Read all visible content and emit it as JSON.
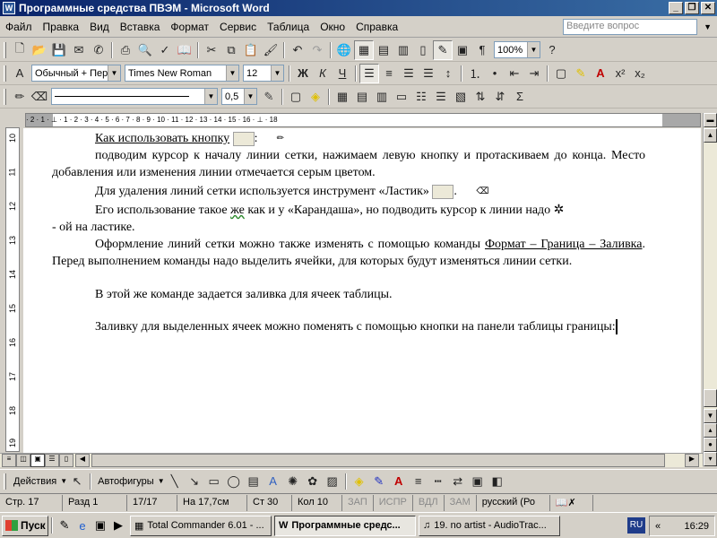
{
  "window": {
    "title": "Программные средства ПВЭМ - Microsoft Word"
  },
  "menu": {
    "items": [
      "Файл",
      "Правка",
      "Вид",
      "Вставка",
      "Формат",
      "Сервис",
      "Таблица",
      "Окно",
      "Справка"
    ],
    "help_placeholder": "Введите вопрос"
  },
  "toolbar": {
    "zoom": "100%",
    "style": "Обычный + Пер",
    "font": "Times New Roman",
    "size": "12",
    "line_weight": "0,5",
    "bold": "Ж",
    "italic": "К",
    "underline": "Ч"
  },
  "ruler": {
    "h_labels": "· 2 · 1 · ⊥ · 1 · 2 · 3 · 4 · 5 · 6 · 7 · 8 · 9 · 10 · 11 · 12 · 13 · 14 · 15 · 16 · ⊥ · 18",
    "v_labels": [
      "10",
      "11",
      "12",
      "13",
      "14",
      "15",
      "16",
      "17",
      "18",
      "19"
    ]
  },
  "document": {
    "p1_link": "Как использовать кнопку",
    "p1_tail": ":",
    "p2": "подводим курсор к началу линии сетки, нажимаем левую кнопку и протаскиваем до конца. Место добавления или изменения линии отмечается серым цветом.",
    "p3": "Для удаления линий сетки используется инструмент «Ластик»",
    "p3_tail": ".",
    "p4_a": "Его использование такое ",
    "p4_wavy": "же",
    "p4_b": " как и у «Карандаша», но подводить курсор к линии надо",
    "p4_c": "- ой на ластике.",
    "p5_a": "Оформление линий сетки можно также изменять с помощью команды ",
    "p5_link": "Формат – Граница – Заливка",
    "p5_b": ". Перед выполнением команды надо выделить ячейки, для которых будут изменяться линии сетки.",
    "p6": "В этой же команде задается заливка для ячеек таблицы.",
    "p7": "Заливку для выделенных ячеек можно поменять с помощью кнопки на панели таблицы границы:"
  },
  "drawbar": {
    "actions": "Действия",
    "autoshapes": "Автофигуры"
  },
  "status": {
    "page": "Стр.  17",
    "section": "Разд  1",
    "pages": "17/17",
    "at": "На  17,7см",
    "line": "Ст  30",
    "col": "Кол  10",
    "rec": "ЗАП",
    "trk": "ИСПР",
    "ext": "ВДЛ",
    "ovr": "ЗАМ",
    "lang": "русский (Ро"
  },
  "taskbar": {
    "start": "Пуск",
    "tasks": [
      "Total Commander 6.01 - ...",
      "Программные средс...",
      "19. no artist - AudioTrac..."
    ],
    "lang": "RU",
    "time": "16:29"
  }
}
